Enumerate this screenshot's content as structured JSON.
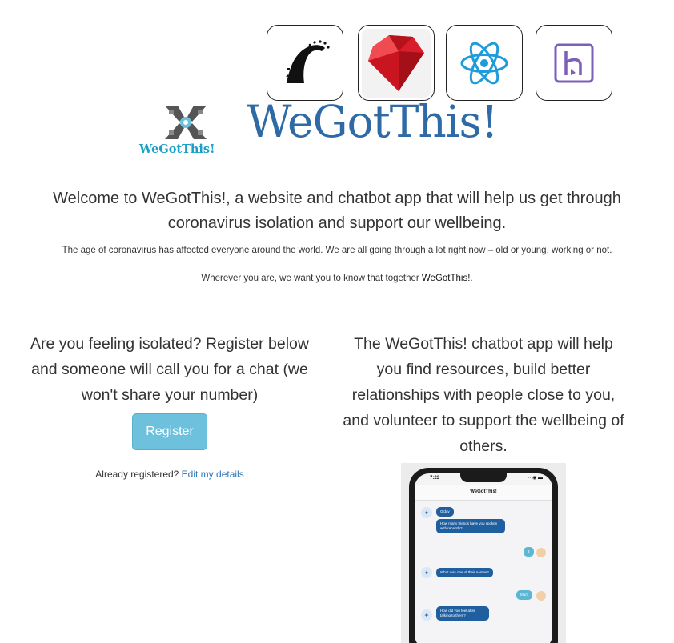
{
  "tech_stack": [
    {
      "name": "rails-icon"
    },
    {
      "name": "ruby-icon"
    },
    {
      "name": "react-icon"
    },
    {
      "name": "heroku-icon"
    }
  ],
  "brand": {
    "logo_text": "WeGotThis!",
    "title": "WeGotThis!",
    "title_color": "#2d6aa6",
    "logo_text_color": "#1aa0c8"
  },
  "welcome": {
    "line1": "Welcome to WeGotThis!, a website and chatbot app that will help us get through",
    "line2": "coronavirus isolation and support our wellbeing."
  },
  "intro": {
    "paragraph1": "The age of coronavirus has affected everyone around the world. We are all going through a lot right now – old or young, working or not.",
    "paragraph2_prefix": "Wherever you are, we want you to know that together ",
    "paragraph2_brand": "WeGotThis!",
    "paragraph2_suffix": "."
  },
  "register_section": {
    "line1": "Are you feeling isolated? Register below",
    "line2": "and someone will call you for a chat (we",
    "line3": "won't share your number)",
    "button_label": "Register",
    "button_color": "#6ec1dc",
    "already_text": "Already registered? ",
    "edit_link": "Edit my details",
    "link_color": "#2f74b5"
  },
  "chatbot_section": {
    "line1": "The WeGotThis! chatbot app will help",
    "line2": "you find resources, build better",
    "line3": "relationships with people close to you,",
    "line4": "and volunteer to support the wellbeing of",
    "line5": "others."
  },
  "phone_mock": {
    "time": "7:23",
    "status_icons": "·· ◉ ▬",
    "header": "WeGotThis!",
    "messages": [
      {
        "from": "bot",
        "text": "G'day"
      },
      {
        "from": "bot",
        "text": "How many friends have you spoken with recently?"
      },
      {
        "from": "user",
        "text": "3"
      },
      {
        "from": "bot",
        "text": "What was one of their names?"
      },
      {
        "from": "user",
        "text": "Mum"
      },
      {
        "from": "bot",
        "text": "How did you feel after talking to them?"
      }
    ]
  }
}
